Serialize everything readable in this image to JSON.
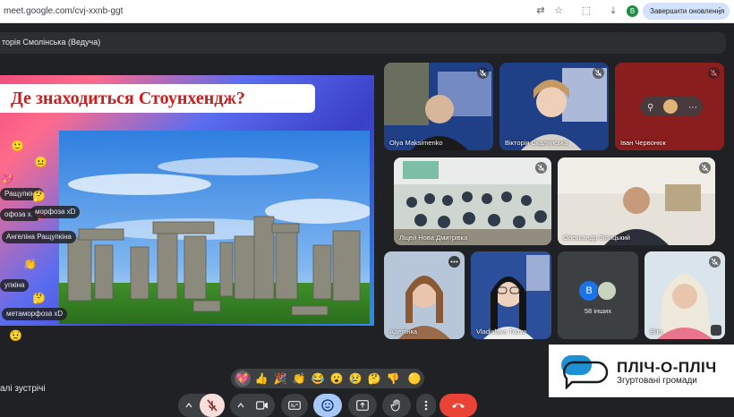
{
  "browser": {
    "url": "meet.google.com/cvj-xxnb-ggt",
    "profile_initial": "В",
    "update_label": "Завершити оновлення"
  },
  "meeting": {
    "title": "торія Смолінська (Ведуча)",
    "footer_label": "алі зустрічі"
  },
  "slide": {
    "title": "Де знаходиться Стоунхендж?"
  },
  "reactions_stream": [
    {
      "name": "Ращупкіна",
      "emoji": "💖"
    },
    {
      "name": "офоза xD",
      "emoji": "💖"
    },
    {
      "name": "морфоза xD",
      "emoji": ""
    },
    {
      "name": "Ангеліна Ращупкіна",
      "emoji": ""
    },
    {
      "name": "упкіна",
      "emoji": "👏"
    },
    {
      "name": "метаморфоза xD",
      "emoji": "🤔"
    }
  ],
  "participants": [
    {
      "name": "Olya Maksimenko"
    },
    {
      "name": "Вікторія Скалянська"
    },
    {
      "name": "Іван Червонюк"
    },
    {
      "name": "Ліцей Нова Дмитрівка"
    },
    {
      "name": "Олександр Зілицький"
    },
    {
      "name": "Аделінка"
    },
    {
      "name": "Vladislava Titova"
    },
    {
      "name": "58 інших",
      "avatar_initial": "В"
    },
    {
      "name": "Віта"
    }
  ],
  "reaction_bar": [
    "💖",
    "👍",
    "🎉",
    "👏",
    "😂",
    "😮",
    "😢",
    "🤔",
    "👎",
    "🟡"
  ],
  "logo": {
    "title": "ПЛІЧ-О-ПЛІЧ",
    "subtitle": "Згуртовані громади"
  },
  "colors": {
    "meet_bg": "#202124",
    "tile_bg": "#3c4043",
    "end_call": "#ea4335",
    "active_blue": "#a8c7fa",
    "muted_red": "#f9dedc"
  }
}
